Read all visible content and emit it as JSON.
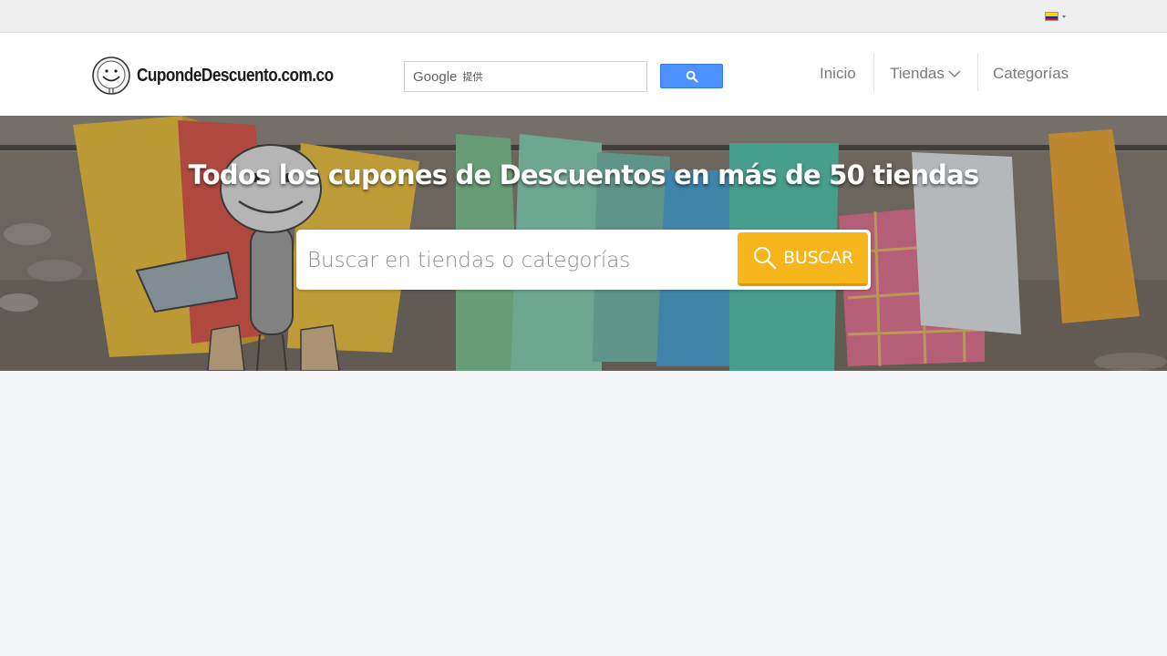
{
  "topbar": {
    "language_flag": "colombia-flag-icon",
    "flag_colors": {
      "yellow": "#fcd116",
      "blue": "#003893",
      "red": "#ce1126"
    }
  },
  "header": {
    "logo_text": "CupondeDescuento.com.co",
    "google_search": {
      "brand": "Google",
      "powered_by": "提供",
      "button_icon": "search-icon",
      "button_color": "#4d90fe"
    },
    "nav": [
      {
        "label": "Inicio"
      },
      {
        "label": "Tiendas",
        "icon": "chevron-down-icon"
      },
      {
        "label": "Categorías"
      }
    ]
  },
  "hero": {
    "title": "Todos los cupones de Descuentos en más de 50 tiendas",
    "search": {
      "placeholder": "Buscar en tiendas o categorías",
      "button_label": "BUSCAR",
      "button_color": "#f6b51a"
    }
  },
  "colors": {
    "page_background": "#f3f5f9",
    "nav_text": "#7b7b7b",
    "accent": "#f6b51a"
  }
}
